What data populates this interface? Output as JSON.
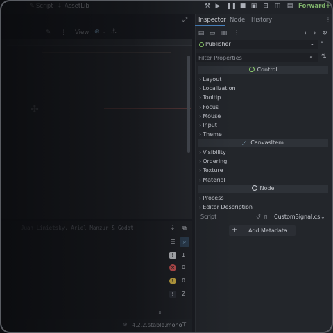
{
  "topbar": {
    "script_label": "Script",
    "assetlib_label": "AssetLib",
    "renderer_label": "Forward+"
  },
  "viewport": {
    "view_menu_label": "View"
  },
  "output": {
    "log_line": "Juan Linietsky, Ariel Manzur & Godot",
    "counts": {
      "messages": "1",
      "errors": "0",
      "warnings": "0",
      "info": "2"
    }
  },
  "status": {
    "version": "4.2.2.stable.mono"
  },
  "inspector": {
    "tabs": [
      "Inspector",
      "Node",
      "History"
    ],
    "selected_node": "Publisher",
    "filter_placeholder": "Filter Properties",
    "sections": [
      {
        "title": "Control",
        "items": [
          "Layout",
          "Localization",
          "Tooltip",
          "Focus",
          "Mouse",
          "Input",
          "Theme"
        ]
      },
      {
        "title": "CanvasItem",
        "items": [
          "Visibility",
          "Ordering",
          "Texture",
          "Material"
        ]
      },
      {
        "title": "Node",
        "items": [
          "Process",
          "Editor Description"
        ]
      }
    ],
    "script_label": "Script",
    "script_value": "CustomSignal.cs",
    "add_metadata_label": "Add Metadata"
  },
  "colors": {
    "accent": "#4a86c5",
    "node_green": "#8fd36f",
    "renderer_green": "#7fb26b",
    "error_red": "#e05a5a",
    "warning_yellow": "#e6c34a"
  }
}
